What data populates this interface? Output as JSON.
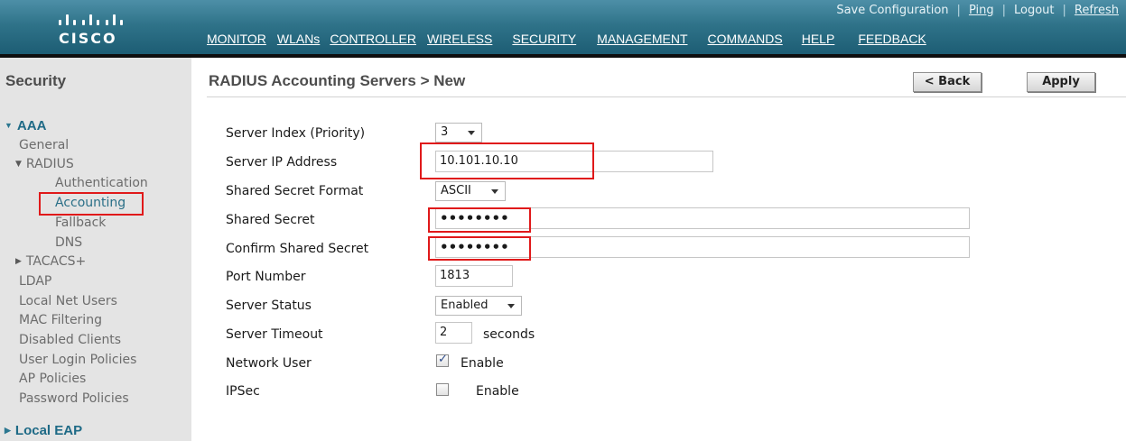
{
  "brand": {
    "name": "CISCO"
  },
  "utility_links": [
    {
      "label": "Save Configuration"
    },
    {
      "label": "Ping"
    },
    {
      "label": "Logout"
    },
    {
      "label": "Refresh"
    }
  ],
  "nav": [
    {
      "label": "MONITOR",
      "active": false
    },
    {
      "label": "WLANs",
      "active": false
    },
    {
      "label": "CONTROLLER",
      "active": false
    },
    {
      "label": "WIRELESS",
      "active": false
    },
    {
      "label": "SECURITY",
      "active": true
    },
    {
      "label": "MANAGEMENT",
      "active": false
    },
    {
      "label": "COMMANDS",
      "active": false
    },
    {
      "label": "HELP",
      "active": false
    },
    {
      "label": "FEEDBACK",
      "active": false
    }
  ],
  "sidebar": {
    "title": "Security",
    "aaa": "AAA",
    "general": "General",
    "radius": "RADIUS",
    "authentication": "Authentication",
    "accounting": "Accounting",
    "fallback": "Fallback",
    "dns": "DNS",
    "tacacs": "TACACS+",
    "ldap": "LDAP",
    "local_net_users": "Local Net Users",
    "mac_filtering": "MAC Filtering",
    "disabled_clients": "Disabled Clients",
    "user_login_policies": "User Login Policies",
    "ap_policies": "AP Policies",
    "password_policies": "Password Policies",
    "local_eap": "Local EAP"
  },
  "page": {
    "title": "RADIUS Accounting Servers > New",
    "back_label": "< Back",
    "apply_label": "Apply"
  },
  "form": {
    "server_index": {
      "label": "Server Index (Priority)",
      "value": "3"
    },
    "server_ip": {
      "label": "Server IP Address",
      "value": "10.101.10.10"
    },
    "secret_format": {
      "label": "Shared Secret Format",
      "value": "ASCII"
    },
    "shared_secret": {
      "label": "Shared Secret",
      "value": "••••••••"
    },
    "confirm_secret": {
      "label": "Confirm Shared Secret",
      "value": "••••••••"
    },
    "port": {
      "label": "Port Number",
      "value": "1813"
    },
    "status": {
      "label": "Server Status",
      "value": "Enabled"
    },
    "timeout": {
      "label": "Server Timeout",
      "value": "2",
      "unit": "seconds"
    },
    "network_user": {
      "label": "Network User",
      "checked": true,
      "option": "Enable"
    },
    "ipsec": {
      "label": "IPSec",
      "checked": false,
      "option": "Enable"
    }
  },
  "colors": {
    "header": "#2f7389",
    "active_tab": "#f7a21a",
    "highlight_box": "#e0191a",
    "sidebar_bg": "#e4e4e4",
    "sidebar_heading": "#1e6a86"
  }
}
